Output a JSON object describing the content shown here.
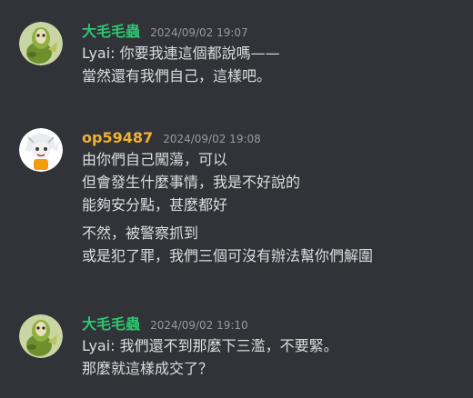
{
  "messages": [
    {
      "username": "大毛毛蟲",
      "username_color": "#2dc770",
      "timestamp": "2024/09/02 19:07",
      "avatar": "green-creature-avatar",
      "lines": [
        "Lyai: 你要我連這個都說嗎——",
        "當然還有我們自己，這樣吧。"
      ]
    },
    {
      "username": "op59487",
      "username_color": "#f0b232",
      "timestamp": "2024/09/02 19:08",
      "avatar": "white-haired-character-avatar",
      "lines": [
        "由你們自己闖蕩，可以",
        "但會發生什麼事情，我是不好說的",
        "能夠安分點，甚麼都好",
        "不然，被警察抓到",
        "或是犯了罪，我們三個可沒有辦法幫你們解圍"
      ]
    },
    {
      "username": "大毛毛蟲",
      "username_color": "#2dc770",
      "timestamp": "2024/09/02 19:10",
      "avatar": "green-creature-avatar",
      "lines": [
        "Lyai: 我們還不到那麼下三濫，不要緊。",
        "那麼就這樣成交了？"
      ]
    }
  ]
}
